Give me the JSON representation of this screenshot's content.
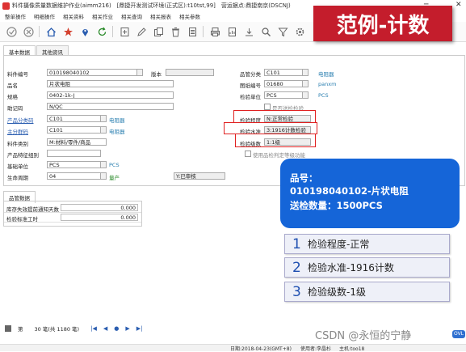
{
  "window": {
    "title": "料件摄像质量数据维护作业(aimm216)　[鼎捷开发测试环境(正式区):t10tst,99]　营运据点:鼎捷南京(DSCNJ)",
    "minimize": "─",
    "close": "✕"
  },
  "menu": [
    "整单操作",
    "明细操作",
    "相关资料",
    "相关作业",
    "相关查询",
    "相关报表",
    "相关参数"
  ],
  "banner": "范例-计数",
  "tabs": [
    "基本数据",
    "其他资讯"
  ],
  "left_form": {
    "part_no_label": "料件编号",
    "part_no": "010198040102",
    "version_label": "版本",
    "name_label": "品名",
    "name": "片状电阻",
    "spec_label": "规格",
    "spec": "0402-1k-J",
    "mnemonic_label": "助记码",
    "mnemonic": "N/QC",
    "product_class_label": "产品分类码",
    "product_class": "C101",
    "product_class_desc": "电阻器",
    "main_group_label": "主分群码",
    "main_group": "C101",
    "main_group_desc": "电阻器",
    "part_type_label": "料件类别",
    "part_type": "M:材料/零件/商品",
    "feature_group_label": "产品特征组别",
    "base_unit_label": "基础单位",
    "base_unit": "PCS",
    "base_unit_desc": "PCS",
    "lifecycle_label": "生命周期",
    "lifecycle": "04",
    "lifecycle_desc": "量产",
    "approval": "Y:已审核"
  },
  "right_form": {
    "mgmt_class_label": "品管分类",
    "mgmt_class": "C101",
    "mgmt_class_desc": "电阻器",
    "drawing_no_label": "图纸编号",
    "drawing_no": "01680",
    "drawing_no_desc": "panxm",
    "inspect_unit_label": "检验单位",
    "inspect_unit": "PCS",
    "inspect_unit_desc": "PCS",
    "include_check_label": "是否送检检验",
    "inspect_level_label": "检验程度",
    "inspect_level": "N:正常检验",
    "inspect_std_label": "检验水准",
    "inspect_std": "3:1916计数检验",
    "inspect_grade_label": "检验级数",
    "inspect_grade": "1:1级",
    "use_plan_label": "使用品检判定等级功能"
  },
  "info_box": {
    "line1": "品号：",
    "line2": "010198040102-片状电阻",
    "line3": "送检数量：1500PCS"
  },
  "steps": [
    {
      "num": "1",
      "text": "检验程度-正常"
    },
    {
      "num": "2",
      "text": "检验水准-1916计数"
    },
    {
      "num": "3",
      "text": "检验级数-1级"
    }
  ],
  "grid": {
    "tab": "品管数据",
    "rows": [
      {
        "label": "库存失效提前通知天数",
        "value": "0.000"
      },
      {
        "label": "检验标准工时",
        "value": "0.000"
      }
    ]
  },
  "pager": {
    "page_label": "第",
    "count_text": "30 笔(共 1180 笔)"
  },
  "status": {
    "date": "日期:2018-04-23(GMT+8)",
    "user": "使用者:李晶杉",
    "host": "主机:too18"
  },
  "watermark": "CSDN @永恒的宁静",
  "ovl_badge": "OVL",
  "colors": {
    "banner": "#c41d2c",
    "info_box": "#1565d8",
    "highlight": "#e02020"
  }
}
